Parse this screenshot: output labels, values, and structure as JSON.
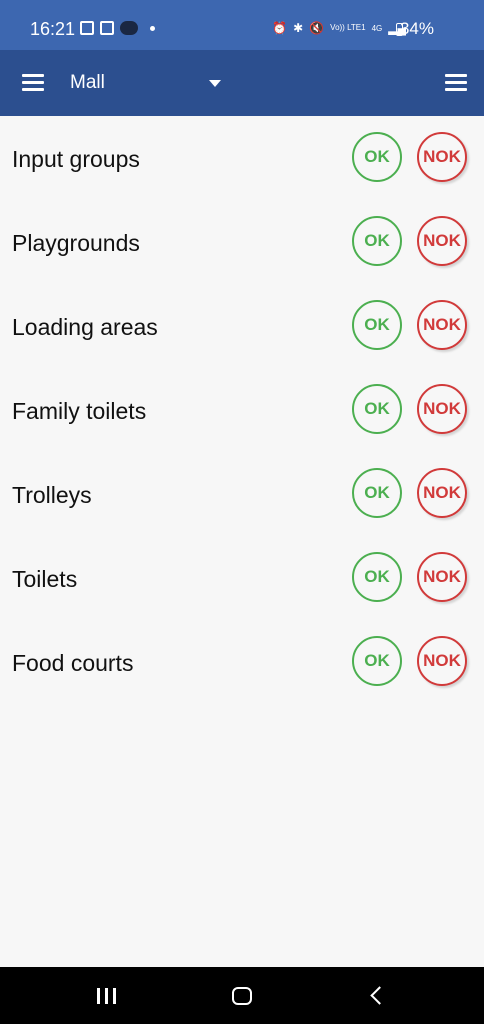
{
  "status_bar": {
    "time": "16:21",
    "network": "4G",
    "volte": "Vo)) LTE1",
    "battery": "34%"
  },
  "app_bar": {
    "title": "Mall"
  },
  "items": [
    {
      "label": "Input groups",
      "ok": "OK",
      "nok": "NOK"
    },
    {
      "label": "Playgrounds",
      "ok": "OK",
      "nok": "NOK"
    },
    {
      "label": "Loading areas",
      "ok": "OK",
      "nok": "NOK"
    },
    {
      "label": "Family toilets",
      "ok": "OK",
      "nok": "NOK"
    },
    {
      "label": "Trolleys",
      "ok": "OK",
      "nok": "NOK"
    },
    {
      "label": "Toilets",
      "ok": "OK",
      "nok": "NOK"
    },
    {
      "label": "Food courts",
      "ok": "OK",
      "nok": "NOK"
    }
  ],
  "colors": {
    "status_bar": "#3d67b0",
    "app_bar": "#2c4f8f",
    "ok": "#4caf50",
    "nok": "#d13a3a"
  },
  "icons": {
    "left_menu": "hamburger-icon",
    "right_menu": "menu-icon",
    "dropdown": "dropdown-arrow-icon"
  }
}
